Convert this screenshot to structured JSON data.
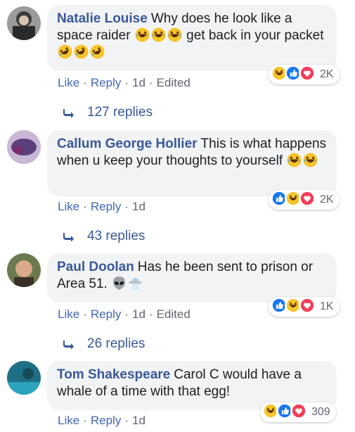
{
  "comments": [
    {
      "author": "Natalie Louise",
      "text_segments": [
        "Why does he look like a space raider",
        "get back in your packet"
      ],
      "emoji_runs": [
        [
          "laugh-cry",
          "laugh-cry",
          "laugh-cry"
        ],
        [
          "rofl",
          "rofl",
          "rofl"
        ]
      ],
      "actions": {
        "like": "Like",
        "reply": "Reply",
        "time": "1d",
        "edited": "Edited"
      },
      "reactions": [
        "haha",
        "like",
        "love"
      ],
      "reaction_count": "2K",
      "replies": "127 replies"
    },
    {
      "author": "Callum George Hollier",
      "text_segments": [
        "This is what happens when u keep your thoughts to yourself"
      ],
      "emoji_runs": [
        [
          "laugh-cry",
          "laugh-cry"
        ]
      ],
      "actions": {
        "like": "Like",
        "reply": "Reply",
        "time": "1d",
        "edited": ""
      },
      "reactions": [
        "like",
        "haha",
        "love"
      ],
      "reaction_count": "2K",
      "replies": "43 replies"
    },
    {
      "author": "Paul Doolan",
      "text_segments": [
        "Has he been sent to prison or Area 51."
      ],
      "emoji_runs": [
        [
          "alien",
          "ufo"
        ]
      ],
      "actions": {
        "like": "Like",
        "reply": "Reply",
        "time": "1d",
        "edited": "Edited"
      },
      "reactions": [
        "like",
        "haha",
        "love"
      ],
      "reaction_count": "1K",
      "replies": "26 replies"
    },
    {
      "author": "Tom Shakespeare",
      "text_segments": [
        "Carol C would have a whale of a time with that egg!"
      ],
      "emoji_runs": [],
      "actions": {
        "like": "Like",
        "reply": "Reply",
        "time": "1d",
        "edited": ""
      },
      "reactions": [
        "haha",
        "like",
        "love"
      ],
      "reaction_count": "309",
      "replies": ""
    }
  ],
  "colors": {
    "link": "#385898",
    "action": "#4267b2",
    "bubble": "#f2f3f5",
    "meta": "#606770"
  }
}
